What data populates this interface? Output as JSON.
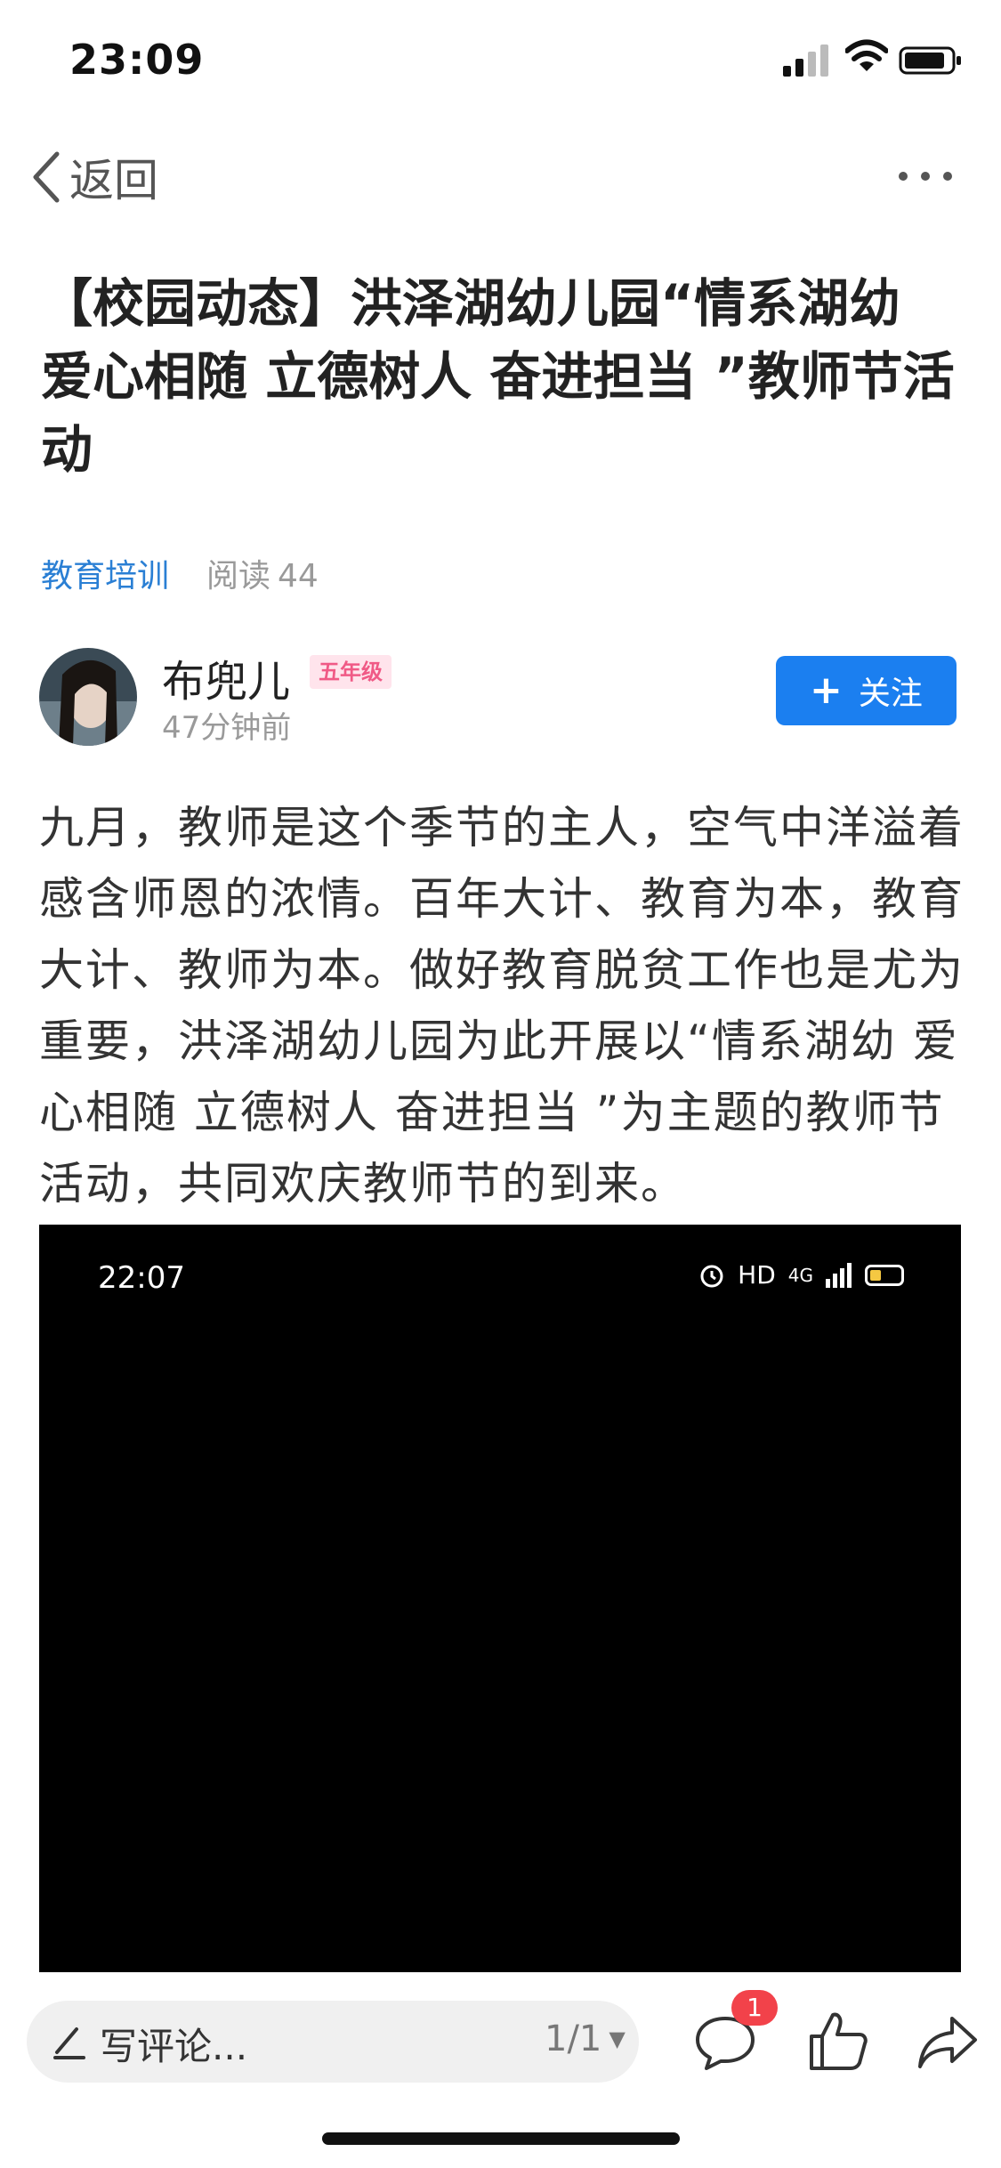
{
  "status_bar": {
    "time": "23:09"
  },
  "nav": {
    "back_label": "返回"
  },
  "article": {
    "title": "【校园动态】洪泽湖幼儿园“情系湖幼 爱心相随 立德树人 奋进担当 ”教师节活动",
    "category": "教育培训",
    "reads_label": "阅读",
    "reads_count": "44",
    "body": "九月，教师是这个季节的主人，空气中洋溢着感含师恩的浓情。百年大计、教育为本，教育大计、教师为本。做好教育脱贫工作也是尤为重要，洪泽湖幼儿园为此开展以“情系湖幼 爱心相随 立德树人 奋进担当 ”为主题的教师节活动，共同欢庆教师节的到来。"
  },
  "author": {
    "name": "布兜儿",
    "grade": "五年级",
    "time": "47分钟前",
    "follow_label": "关注"
  },
  "media": {
    "time": "22:07",
    "hd": "HD",
    "network": "4G"
  },
  "bottom_bar": {
    "comment_placeholder": "写评论...",
    "pager": "1/1",
    "comment_count": "1"
  },
  "icons": [
    "chevron-left-icon",
    "more-icon",
    "signal-icon",
    "wifi-icon",
    "battery-icon",
    "plus-icon",
    "pen-icon",
    "comment-icon",
    "like-icon",
    "share-icon",
    "alarm-icon"
  ]
}
